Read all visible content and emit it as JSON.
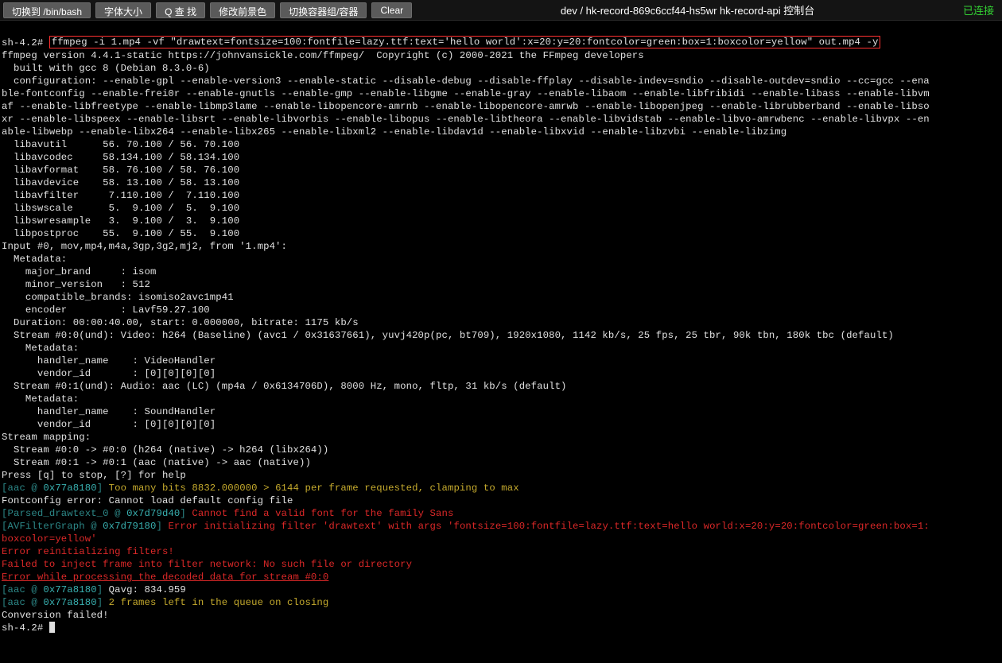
{
  "toolbar": {
    "switch_label": "切换到 /bin/bash",
    "font_label": "字体大小",
    "find_label": "Q 查 找",
    "fg_label": "修改前景色",
    "container_label": "切换容器组/容器",
    "clear_label": "Clear"
  },
  "title": "dev / hk-record-869c6ccf44-hs5wr hk-record-api 控制台",
  "status": "已连接",
  "term": {
    "prompt": "sh-4.2# ",
    "cmd": "ffmpeg -i 1.mp4 -vf \"drawtext=fontsize=100:fontfile=lazy.ttf:text='hello world':x=20:y=20:fontcolor=green:box=1:boxcolor=yellow\" out.mp4 -y",
    "l2": "ffmpeg version 4.4.1-static https://johnvansickle.com/ffmpeg/  Copyright (c) 2000-2021 the FFmpeg developers",
    "l3": "  built with gcc 8 (Debian 8.3.0-6)",
    "l4": "  configuration: --enable-gpl --enable-version3 --enable-static --disable-debug --disable-ffplay --disable-indev=sndio --disable-outdev=sndio --cc=gcc --ena",
    "l5": "ble-fontconfig --enable-frei0r --enable-gnutls --enable-gmp --enable-libgme --enable-gray --enable-libaom --enable-libfribidi --enable-libass --enable-libvm",
    "l6": "af --enable-libfreetype --enable-libmp3lame --enable-libopencore-amrnb --enable-libopencore-amrwb --enable-libopenjpeg --enable-librubberband --enable-libso",
    "l7": "xr --enable-libspeex --enable-libsrt --enable-libvorbis --enable-libopus --enable-libtheora --enable-libvidstab --enable-libvo-amrwbenc --enable-libvpx --en",
    "l8": "able-libwebp --enable-libx264 --enable-libx265 --enable-libxml2 --enable-libdav1d --enable-libxvid --enable-libzvbi --enable-libzimg",
    "l9": "  libavutil      56. 70.100 / 56. 70.100",
    "l10": "  libavcodec     58.134.100 / 58.134.100",
    "l11": "  libavformat    58. 76.100 / 58. 76.100",
    "l12": "  libavdevice    58. 13.100 / 58. 13.100",
    "l13": "  libavfilter     7.110.100 /  7.110.100",
    "l14": "  libswscale      5.  9.100 /  5.  9.100",
    "l15": "  libswresample   3.  9.100 /  3.  9.100",
    "l16": "  libpostproc    55.  9.100 / 55.  9.100",
    "l17": "Input #0, mov,mp4,m4a,3gp,3g2,mj2, from '1.mp4':",
    "l18": "  Metadata:",
    "l19": "    major_brand     : isom",
    "l20": "    minor_version   : 512",
    "l21": "    compatible_brands: isomiso2avc1mp41",
    "l22": "    encoder         : Lavf59.27.100",
    "l23": "  Duration: 00:00:40.00, start: 0.000000, bitrate: 1175 kb/s",
    "l24": "  Stream #0:0(und): Video: h264 (Baseline) (avc1 / 0x31637661), yuvj420p(pc, bt709), 1920x1080, 1142 kb/s, 25 fps, 25 tbr, 90k tbn, 180k tbc (default)",
    "l25": "    Metadata:",
    "l26": "      handler_name    : VideoHandler",
    "l27": "      vendor_id       : [0][0][0][0]",
    "l28": "  Stream #0:1(und): Audio: aac (LC) (mp4a / 0x6134706D), 8000 Hz, mono, fltp, 31 kb/s (default)",
    "l29": "    Metadata:",
    "l30": "      handler_name    : SoundHandler",
    "l31": "      vendor_id       : [0][0][0][0]",
    "l32": "Stream mapping:",
    "l33": "  Stream #0:0 -> #0:0 (h264 (native) -> h264 (libx264))",
    "l34": "  Stream #0:1 -> #0:1 (aac (native) -> aac (native))",
    "l35": "Press [q] to stop, [?] for help",
    "aac1_tag": "[aac @ ",
    "aac1_addr": "0x77a8180",
    "aac1_tag2": "] ",
    "aac1_msg": "Too many bits 8832.000000 > 6144 per frame requested, clamping to max",
    "l37": "Fontconfig error: Cannot load default config file",
    "pd_tag": "[Parsed_drawtext_0 @ ",
    "pd_addr": "0x7d79d40",
    "pd_tag2": "] ",
    "pd_msg": "Cannot find a valid font for the family Sans",
    "fg_tag": "[AVFilterGraph @ ",
    "fg_addr": "0x7d79180",
    "fg_tag2": "] ",
    "fg_msg": "Error initializing filter 'drawtext' with args 'fontsize=100:fontfile=lazy.ttf:text=hello world:x=20:y=20:fontcolor=green:box=1:",
    "fg_msg2": "boxcolor=yellow'",
    "l41": "Error reinitializing filters!",
    "l42": "Failed to inject frame into filter network: No such file or directory",
    "l43": "Error while processing the decoded data for stream #0:0",
    "aac2_msg": "Qavg: 834.959",
    "aac3_msg": "2 frames left in the queue on closing",
    "l46": "Conversion failed!",
    "l47": "sh-4.2# "
  }
}
